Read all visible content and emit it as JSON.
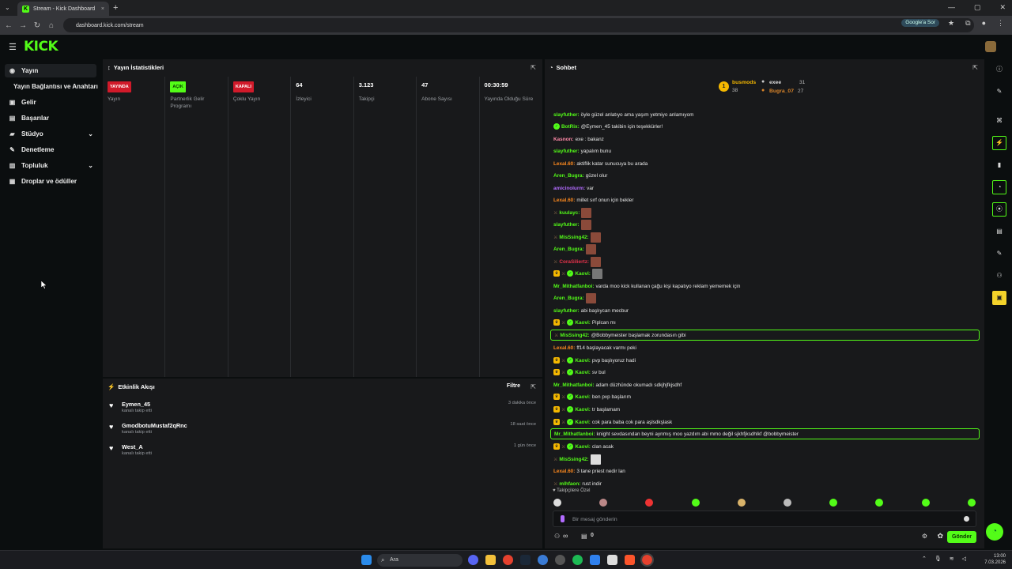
{
  "browser": {
    "tab_title": "Stream - Kick Dashboard",
    "url": "dashboard.kick.com/stream",
    "google_ask": "Google'a Sor"
  },
  "logo": "KICK",
  "sidebar": {
    "items": [
      {
        "label": "Yayın",
        "icon": "broadcast-icon"
      },
      {
        "label": "Yayın Bağlantısı ve Anahtarı",
        "icon": ""
      },
      {
        "label": "Gelir",
        "icon": "money-icon"
      },
      {
        "label": "Başarılar",
        "icon": "trophy-icon"
      },
      {
        "label": "Stüdyo",
        "icon": "studio-icon"
      },
      {
        "label": "Denetleme",
        "icon": "wrench-icon"
      },
      {
        "label": "Topluluk",
        "icon": "community-icon"
      },
      {
        "label": "Droplar ve ödüller",
        "icon": "gift-icon"
      }
    ]
  },
  "stats": {
    "title": "Yayın İstatistikleri",
    "columns": [
      {
        "badge": "YAYINDA",
        "badge_color": "#d11a2a",
        "label": "Yayın"
      },
      {
        "badge": "AÇIK",
        "badge_color": "#53fc18",
        "label": "Partnerlik Gelir Programı"
      },
      {
        "badge": "KAPALI",
        "badge_color": "#d11a2a",
        "label": "Çoklu Yayın"
      },
      {
        "value": "64",
        "label": "İzleyici"
      },
      {
        "value": "3.123",
        "label": "Takipçi"
      },
      {
        "value": "47",
        "label": "Abone Sayısı"
      },
      {
        "value": "00:30:59",
        "label": "Yayında Olduğu Süre"
      }
    ]
  },
  "activity": {
    "title": "Etkinlik Akışı",
    "filter_label": "Filtre",
    "items": [
      {
        "user": "Eymen_45",
        "sub": "kanalı takip etti",
        "time": "3 dakika önce"
      },
      {
        "user": "GmodbotuMustaf2qRnc",
        "sub": "kanalı takip etti",
        "time": "18 saat önce"
      },
      {
        "user": "West_A",
        "sub": "kanalı takip etti",
        "time": "1 gün önce"
      }
    ]
  },
  "chat": {
    "title": "Sohbet",
    "leaderboard": {
      "first": {
        "name": "busmods",
        "count": "38"
      },
      "second": {
        "name": "exee",
        "count": "31"
      },
      "third": {
        "name": "Bugra_07",
        "count": "27"
      }
    },
    "messages": [
      {
        "user": "slayfuther",
        "color": "#53fc18",
        "text": "öyle güzel anlatıyo ama yaşım yetmiyo anlamıyom"
      },
      {
        "user": "BotRix",
        "color": "#53fc18",
        "text": "@Eymen_45 takibin için teşekkürler!"
      },
      {
        "user": "Kasnon",
        "color": "#ff8aa8",
        "text": "exe : bakanz"
      },
      {
        "user": "slayfuther",
        "color": "#53fc18",
        "text": "yapalım bunu"
      },
      {
        "user": "Lexal.60",
        "color": "#ff8a1e",
        "text": "aktiflik katar sunucuya bu arada"
      },
      {
        "user": "Aren_Bugra",
        "color": "#53fc18",
        "text": "güzel olur"
      },
      {
        "user": "amicinolurm",
        "color": "#b26bff",
        "text": "var"
      },
      {
        "user": "Lexal.60",
        "color": "#ff8a1e",
        "text": "millet sırf onun için bekler"
      },
      {
        "user": "kuulayc",
        "color": "#53fc18",
        "text": ""
      },
      {
        "user": "slayfuther",
        "color": "#53fc18",
        "text": ""
      },
      {
        "user": "MisSsing42",
        "color": "#53fc18",
        "text": ""
      },
      {
        "user": "Aren_Bugra",
        "color": "#53fc18",
        "text": ""
      },
      {
        "user": "CoraSiliertz",
        "color": "#e6324b",
        "text": ""
      },
      {
        "user": "Kaovi",
        "color": "#53fc18",
        "text": ""
      },
      {
        "user": "Mr_Mithatfanboi",
        "color": "#53fc18",
        "text": "varda moo kick kullanan çağu kişi kapatıyo reklam yememek için"
      },
      {
        "user": "Aren_Bugra",
        "color": "#53fc18",
        "text": ""
      },
      {
        "user": "slayfuther",
        "color": "#53fc18",
        "text": "abi başlıycan mecbur"
      },
      {
        "user": "Kaovi",
        "color": "#53fc18",
        "text": "Piplcan mı"
      },
      {
        "user": "MisSsing42",
        "color": "#53fc18",
        "text": "@Bobbymeister başlamak zorundasın gibi"
      },
      {
        "user": "Lexal.60",
        "color": "#ff8a1e",
        "text": "ff14 başlayacak varmı peki"
      },
      {
        "user": "Kaovi",
        "color": "#53fc18",
        "text": "pvp başlıyoruz hadi"
      },
      {
        "user": "Kaovi",
        "color": "#53fc18",
        "text": "sv bul"
      },
      {
        "user": "Mr_Mithatfanboi",
        "color": "#53fc18",
        "text": "adam düzhünde okumadı sdkjhjfkjsdhf"
      },
      {
        "user": "Kaovi",
        "color": "#53fc18",
        "text": "ben pvp başlarım"
      },
      {
        "user": "Kaovi",
        "color": "#53fc18",
        "text": "tr başlamam"
      },
      {
        "user": "Kaovi",
        "color": "#53fc18",
        "text": "cok para baba cok para aşlsdkşlask"
      },
      {
        "user": "Mr_Mithatfanboi",
        "color": "#53fc18",
        "text": "knight sevdasından beyni aynmış moo yazdım abi mmo değil sjkhfjksdhlkf @bobbymeister"
      },
      {
        "user": "Kaovi",
        "color": "#53fc18",
        "text": "clan acak"
      },
      {
        "user": "MisSsing42",
        "color": "#53fc18",
        "text": ""
      },
      {
        "user": "Lexal.60",
        "color": "#ff8a1e",
        "text": "3 tane priest nedir lan"
      },
      {
        "user": "mlhfaon",
        "color": "#53fc18",
        "text": "rust indir"
      }
    ],
    "followers_only": "Takipçilere Özel",
    "input_placeholder": "Bir mesaj gönderin",
    "counter_a": "∞",
    "counter_b": "0",
    "send_label": "Gönder"
  },
  "taskbar": {
    "search": "Ara",
    "time": "13:00",
    "date": "7.03.2026"
  }
}
